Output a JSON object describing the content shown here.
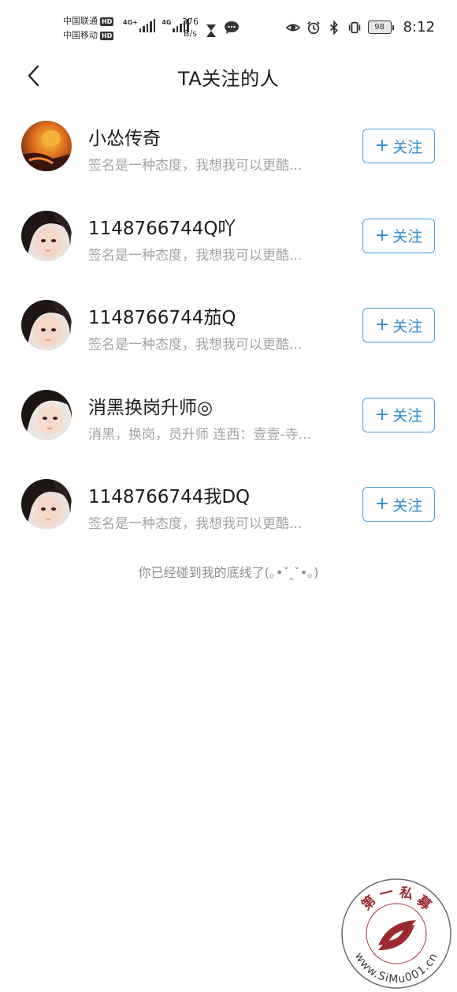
{
  "status_bar": {
    "carrier1": "中国联通",
    "carrier2": "中国移动",
    "hd_badge": "HD",
    "network_tag_1": "4G+",
    "network_tag_2": "4G",
    "speed_value": "376",
    "speed_unit": "B/s",
    "battery": "98",
    "time": "8:12",
    "icons": [
      "hourglass-icon",
      "chat-bubble-icon",
      "eye-icon",
      "alarm-icon",
      "bluetooth-icon",
      "vibrate-icon",
      "battery-icon"
    ]
  },
  "header": {
    "title": "TA关注的人",
    "back_icon": "chevron-left-icon"
  },
  "follow_label": "关注",
  "users": [
    {
      "name": "小怂传奇",
      "signature": "签名是一种态度，我想我可以更酷...",
      "avatar": "orange-photo"
    },
    {
      "name": "1148766744Q吖",
      "signature": "签名是一种态度，我想我可以更酷...",
      "avatar": "girl-photo"
    },
    {
      "name": "1148766744茄Q",
      "signature": "签名是一种态度，我想我可以更酷...",
      "avatar": "girl-photo"
    },
    {
      "name": "消黑换岗升师◎",
      "signature": "消黑，换岗，员升师  连西：壹壹-寺...",
      "avatar": "girl-photo"
    },
    {
      "name": "1148766744我DQ",
      "signature": "签名是一种态度，我想我可以更酷...",
      "avatar": "girl-photo"
    }
  ],
  "end_text": "你已经碰到我的底线了(｡•ˇ‸ˇ•｡)",
  "watermark": {
    "top_text": "第 一 私 募",
    "bottom_text": "www.SiMu001.cn"
  },
  "colors": {
    "accent": "#2f8ad0",
    "button_border": "#4e9fd8",
    "secondary_text": "#a3a3a3",
    "watermark_red": "#9b2a2f"
  }
}
